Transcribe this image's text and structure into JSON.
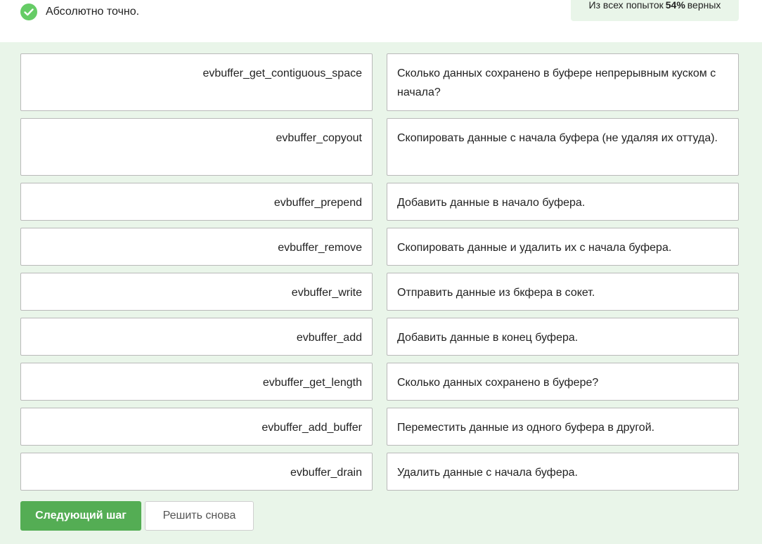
{
  "feedback": {
    "status_text": "Абсолютно точно.",
    "status_icon": "check-circle-icon",
    "status_color": "#66cc66"
  },
  "attempts": {
    "prefix": "Из всех попыток",
    "percent": "54%",
    "suffix": "верных"
  },
  "pairs": [
    {
      "term": "evbuffer_get_contiguous_space",
      "definition": "Сколько данных сохранено в буфере непрерывным куском с начала?"
    },
    {
      "term": "evbuffer_copyout",
      "definition": "Скопировать данные с начала буфера (не удаляя их оттуда)."
    },
    {
      "term": "evbuffer_prepend",
      "definition": "Добавить данные в начало буфера."
    },
    {
      "term": "evbuffer_remove",
      "definition": "Скопировать данные и удалить их с начала буфера."
    },
    {
      "term": "evbuffer_write",
      "definition": "Отправить данные из бкфера в сокет."
    },
    {
      "term": "evbuffer_add",
      "definition": "Добавить данные в конец буфера."
    },
    {
      "term": "evbuffer_get_length",
      "definition": "Сколько данных сохранено в буфере?"
    },
    {
      "term": "evbuffer_add_buffer",
      "definition": "Переместить данные из одного буфера в другой."
    },
    {
      "term": "evbuffer_drain",
      "definition": "Удалить данные с начала буфера."
    }
  ],
  "actions": {
    "next_label": "Следующий шаг",
    "retry_label": "Решить снова",
    "accent_color": "#54ad54"
  }
}
